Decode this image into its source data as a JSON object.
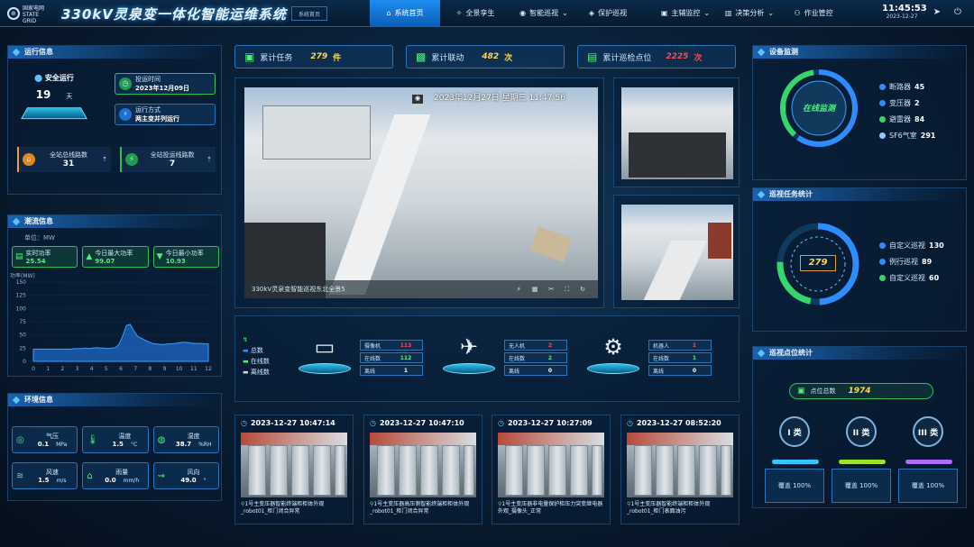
{
  "header": {
    "logo_line1": "国家电网",
    "logo_line2": "STATE GRID",
    "title": "330kV灵泉变一体化智能运维系统",
    "sys_btn": "系统首页",
    "nav": [
      {
        "label": "系统首页",
        "active": true
      },
      {
        "label": "全景孪生"
      },
      {
        "label": "智能巡视"
      },
      {
        "label": "保护巡视"
      },
      {
        "label": "主辅监控"
      },
      {
        "label": "决策分析"
      },
      {
        "label": "作业管控"
      }
    ],
    "time": "11:45:53",
    "date": "2023-12-27"
  },
  "run": {
    "title": "运行信息",
    "safe_label": "安全运行",
    "safe_days": "19",
    "safe_unit": "天",
    "put_label": "投运时间",
    "put_value": "2023年12月09日",
    "mode_label": "运行方式",
    "mode_value": "两主变并列运行",
    "total_lines_label": "全站总线路数",
    "total_lines": "31",
    "run_lines_label": "全站投运线路数",
    "run_lines": "7"
  },
  "flow": {
    "title": "潮流信息",
    "unit": "单位：MW",
    "cards": [
      {
        "label": "实时功率",
        "value": "25.54"
      },
      {
        "label": "今日最大功率",
        "value": "99.07"
      },
      {
        "label": "今日最小功率",
        "value": "10.93"
      }
    ]
  },
  "env": {
    "title": "环境信息",
    "items": [
      {
        "label": "气压",
        "value": "0.1",
        "unit": "MPa"
      },
      {
        "label": "温度",
        "value": "1.5",
        "unit": "°C"
      },
      {
        "label": "湿度",
        "value": "38.7",
        "unit": "%RH"
      },
      {
        "label": "风速",
        "value": "1.5",
        "unit": "m/s"
      },
      {
        "label": "雨量",
        "value": "0.0",
        "unit": "mm/h"
      },
      {
        "label": "风向",
        "value": "49.0",
        "unit": "°"
      }
    ]
  },
  "tops": [
    {
      "label": "累计任务",
      "value": "279",
      "unit": "件"
    },
    {
      "label": "累计联动",
      "value": "482",
      "unit": "次"
    },
    {
      "label": "累计巡检点位",
      "value": "2225",
      "unit": "次"
    }
  ],
  "video": {
    "timestamp": "2023年12月27日  星期三  11:47:56",
    "caption": "330kV灵泉变智能巡视东北全景5"
  },
  "robots": {
    "legend": [
      "总数",
      "在线数",
      "离线数"
    ],
    "groups": [
      {
        "name": "摄像机",
        "total": "113",
        "online": "112",
        "offline": "1"
      },
      {
        "name": "无人机",
        "total": "2",
        "online": "2",
        "offline": "0"
      },
      {
        "name": "机器人",
        "total": "1",
        "online": "1",
        "offline": "0"
      }
    ],
    "online_label": "在线数",
    "offline_label": "离线"
  },
  "alarms": [
    {
      "time": "2023-12-27 10:47:14",
      "text": "1号主变压器智能终端柜柜体外观_robot01_柜门闭合异常"
    },
    {
      "time": "2023-12-27 10:47:10",
      "text": "1号主变压器高压侧智能终端柜柜体外观_robot01_柜门闭合异常"
    },
    {
      "time": "2023-12-27 10:27:09",
      "text": "1号主变压器非电量保护柜压力突变继电器外观_摄像头_正常"
    },
    {
      "time": "2023-12-27 08:52:20",
      "text": "1号主变压器智能终端柜柜体外观_robot01_柜门表面油污"
    }
  ],
  "devices": {
    "title": "设备监测",
    "center": "在线监测",
    "items": [
      {
        "label": "断路器",
        "value": "45",
        "color": "#2f8cff"
      },
      {
        "label": "变压器",
        "value": "2",
        "color": "#2f8cff"
      },
      {
        "label": "避雷器",
        "value": "84",
        "color": "#35d66b"
      },
      {
        "label": "SF6气室",
        "value": "291",
        "color": "#8ec9ff"
      }
    ]
  },
  "tasks": {
    "title": "巡视任务统计",
    "total": "279",
    "items": [
      {
        "label": "自定义巡视",
        "value": "130",
        "color": "#2f8cff"
      },
      {
        "label": "例行巡视",
        "value": "89",
        "color": "#2f8cff"
      },
      {
        "label": "自定义巡视",
        "value": "60",
        "color": "#35d66b"
      }
    ]
  },
  "points": {
    "title": "巡视点位统计",
    "total_label": "点位总数",
    "total": "1974",
    "classes": [
      {
        "label": "I 类",
        "color": "#35c6ff",
        "cover": "覆盖 100%"
      },
      {
        "label": "II 类",
        "color": "#9be22d",
        "cover": "覆盖 100%"
      },
      {
        "label": "III 类",
        "color": "#b06bff",
        "cover": "覆盖 100%"
      }
    ]
  },
  "chart_data": {
    "type": "area",
    "ylabel": "功率(MW)",
    "ylim": [
      0,
      150
    ],
    "yticks": [
      0,
      25,
      50,
      75,
      100,
      125,
      150
    ],
    "x": [
      0,
      1,
      2,
      3,
      4,
      5,
      6,
      7,
      8,
      9,
      10,
      11,
      12
    ],
    "values": [
      23,
      23,
      23,
      23,
      23,
      23,
      23,
      23,
      23,
      23,
      23,
      24,
      24,
      24,
      25,
      24,
      25,
      26,
      25,
      25,
      24,
      25,
      26,
      32,
      48,
      68,
      70,
      58,
      47,
      44,
      40,
      37,
      34,
      33,
      32,
      32,
      33,
      33,
      34,
      35,
      36,
      36,
      35,
      34,
      34,
      34,
      33,
      33
    ]
  }
}
